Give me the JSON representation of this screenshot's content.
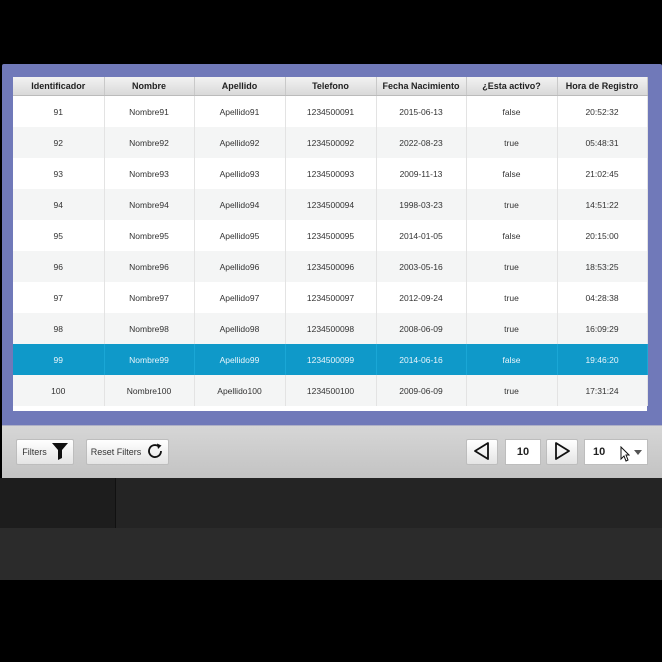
{
  "table": {
    "columns": [
      "Identificador",
      "Nombre",
      "Apellido",
      "Telefono",
      "Fecha Nacimiento",
      "¿Esta activo?",
      "Hora de Registro"
    ],
    "rows": [
      [
        "91",
        "Nombre91",
        "Apellido91",
        "1234500091",
        "2015-06-13",
        "false",
        "20:52:32"
      ],
      [
        "92",
        "Nombre92",
        "Apellido92",
        "1234500092",
        "2022-08-23",
        "true",
        "05:48:31"
      ],
      [
        "93",
        "Nombre93",
        "Apellido93",
        "1234500093",
        "2009-11-13",
        "false",
        "21:02:45"
      ],
      [
        "94",
        "Nombre94",
        "Apellido94",
        "1234500094",
        "1998-03-23",
        "true",
        "14:51:22"
      ],
      [
        "95",
        "Nombre95",
        "Apellido95",
        "1234500095",
        "2014-01-05",
        "false",
        "20:15:00"
      ],
      [
        "96",
        "Nombre96",
        "Apellido96",
        "1234500096",
        "2003-05-16",
        "true",
        "18:53:25"
      ],
      [
        "97",
        "Nombre97",
        "Apellido97",
        "1234500097",
        "2012-09-24",
        "true",
        "04:28:38"
      ],
      [
        "98",
        "Nombre98",
        "Apellido98",
        "1234500098",
        "2008-06-09",
        "true",
        "16:09:29"
      ],
      [
        "99",
        "Nombre99",
        "Apellido99",
        "1234500099",
        "2014-06-16",
        "false",
        "19:46:20"
      ],
      [
        "100",
        "Nombre100",
        "Apellido100",
        "1234500100",
        "2009-06-09",
        "true",
        "17:31:24"
      ]
    ],
    "selected_row": "99"
  },
  "toolbar": {
    "filters_label": "Filters",
    "filters_icon": "funnel-icon",
    "reset_label": "Reset Filters",
    "reset_icon": "refresh-icon",
    "prev_icon": "triangle-left-icon",
    "next_icon": "triangle-right-icon",
    "page_value": "10",
    "page_size_value": "10"
  },
  "colors": {
    "frame": "#7079b9",
    "selected_row": "#0f99c9",
    "toolbar": "#c9c9c9"
  }
}
